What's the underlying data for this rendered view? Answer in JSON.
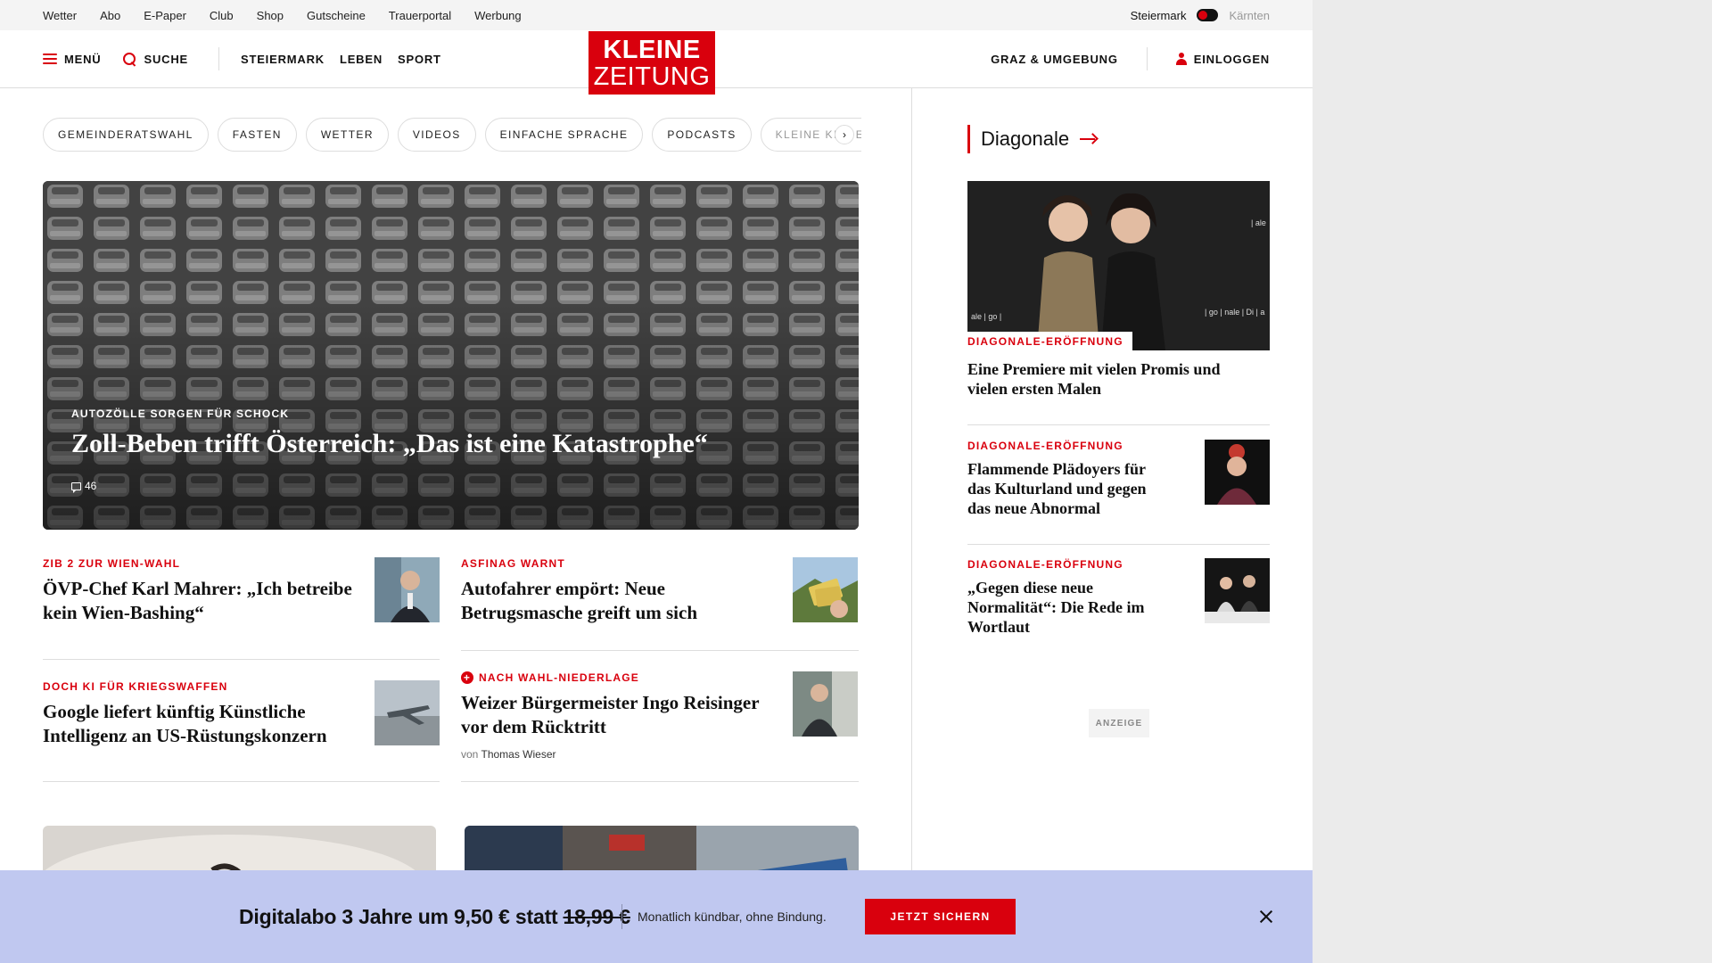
{
  "utility": {
    "links": [
      "Wetter",
      "Abo",
      "E-Paper",
      "Club",
      "Shop",
      "Gutscheine",
      "Trauerportal",
      "Werbung"
    ],
    "region_active": "Steiermark",
    "region_inactive": "Kärnten"
  },
  "header": {
    "menu_label": "MENÜ",
    "search_label": "SUCHE",
    "nav": [
      "STEIERMARK",
      "LEBEN",
      "SPORT"
    ],
    "logo_line1": "KLEINE",
    "logo_line2": "ZEITUNG",
    "local_label": "GRAZ & UMGEBUNG",
    "login_label": "EINLOGGEN"
  },
  "pills": [
    "GEMEINDERATSWAHL",
    "FASTEN",
    "WETTER",
    "VIDEOS",
    "EINFACHE SPRACHE",
    "PODCASTS",
    "KLEINE KINDE"
  ],
  "pills_next": "›",
  "hero": {
    "kicker": "AUTOZÖLLE SORGEN FÜR SCHOCK",
    "headline": "Zoll-Beben trifft Österreich: „Das ist eine Katastrophe“",
    "comments": "46"
  },
  "teasers": [
    {
      "kicker": "ZIB 2 ZUR WIEN-WAHL",
      "title": "ÖVP-Chef Karl Mahrer: „Ich betreibe kein Wien-Bashing“"
    },
    {
      "kicker": "ASFINAG WARNT",
      "title": "Autofahrer empört: Neue Betrugsmasche greift um sich"
    },
    {
      "kicker": "DOCH KI FÜR KRIEGSWAFFEN",
      "title": "Google liefert künftig Künstliche Intelligenz an US-Rüstungskonzern"
    },
    {
      "kicker": "NACH WAHL-NIEDERLAGE",
      "title": "Weizer Bürgermeister Ingo Reisinger vor dem Rücktritt",
      "byline_prefix": "von",
      "byline_author": "Thomas Wieser",
      "premium_badge": "+"
    }
  ],
  "sidebar": {
    "heading": "Diagonale",
    "main_kicker": "DIAGONALE-ERÖFFNUNG",
    "main_title": "Eine Premiere mit vielen Promis und vielen ersten Malen",
    "items": [
      {
        "kicker": "DIAGONALE-ERÖFFNUNG",
        "title": "Flammende Plädoyers für das Kulturland und gegen das neue Abnormal"
      },
      {
        "kicker": "DIAGONALE-ERÖFFNUNG",
        "title": "„Gegen diese neue Normalität“: Die Rede im Wortlaut"
      }
    ],
    "ad_label": "ANZEIGE"
  },
  "promo": {
    "offer": "Digitalabo 3 Jahre um 9,50 € statt",
    "old_price": "18,99 €",
    "note": "Monatlich kündbar, ohne Bindung.",
    "cta": "JETZT SICHERN"
  },
  "colors": {
    "brand_red": "#d9000d",
    "promo_bg": "#c0c8f0",
    "gutter": "#ebebeb"
  }
}
